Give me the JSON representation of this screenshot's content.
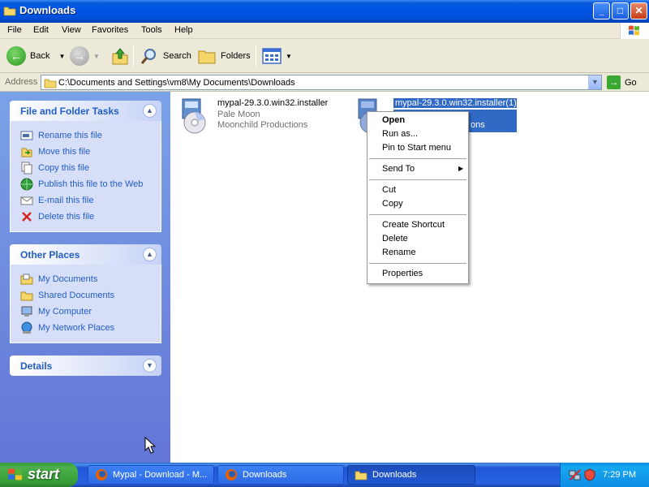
{
  "window": {
    "title": "Downloads",
    "controls": {
      "minimize": "_",
      "maximize": "□",
      "close": "✕"
    }
  },
  "menu": [
    "File",
    "Edit",
    "View",
    "Favorites",
    "Tools",
    "Help"
  ],
  "toolbar": {
    "back": "Back",
    "search": "Search",
    "folders": "Folders"
  },
  "address": {
    "label": "Address",
    "path": "C:\\Documents and Settings\\vm8\\My Documents\\Downloads",
    "go": "Go"
  },
  "tasks": {
    "file_folder": {
      "title": "File and Folder Tasks",
      "items": [
        "Rename this file",
        "Move this file",
        "Copy this file",
        "Publish this file to the Web",
        "E-mail this file",
        "Delete this file"
      ]
    },
    "other_places": {
      "title": "Other Places",
      "items": [
        "My Documents",
        "Shared Documents",
        "My Computer",
        "My Network Places"
      ]
    },
    "details": {
      "title": "Details"
    }
  },
  "files": [
    {
      "name": "mypal-29.3.0.win32.installer",
      "line2": "Pale Moon",
      "line3": "Moonchild Productions",
      "selected": false
    },
    {
      "name": "mypal-29.3.0.win32.installer(1)",
      "line2": "",
      "line3": "ons",
      "selected": true
    }
  ],
  "context_menu": {
    "open": "Open",
    "run_as": "Run as...",
    "pin": "Pin to Start menu",
    "send_to": "Send To",
    "cut": "Cut",
    "copy": "Copy",
    "create_shortcut": "Create Shortcut",
    "delete": "Delete",
    "rename": "Rename",
    "properties": "Properties"
  },
  "taskbar": {
    "start": "start",
    "tasks": [
      {
        "label": "Mypal - Download - M...",
        "icon": "firefox-icon",
        "active": false
      },
      {
        "label": "Downloads",
        "icon": "firefox-icon",
        "active": false
      },
      {
        "label": "Downloads",
        "icon": "folder-icon",
        "active": true
      }
    ],
    "clock": "7:29 PM"
  },
  "colors": {
    "titlebar": "#0054e3",
    "taskpane": "#6375d6",
    "link": "#215dc6",
    "selection": "#316ac5",
    "start": "#3c9a3c"
  }
}
